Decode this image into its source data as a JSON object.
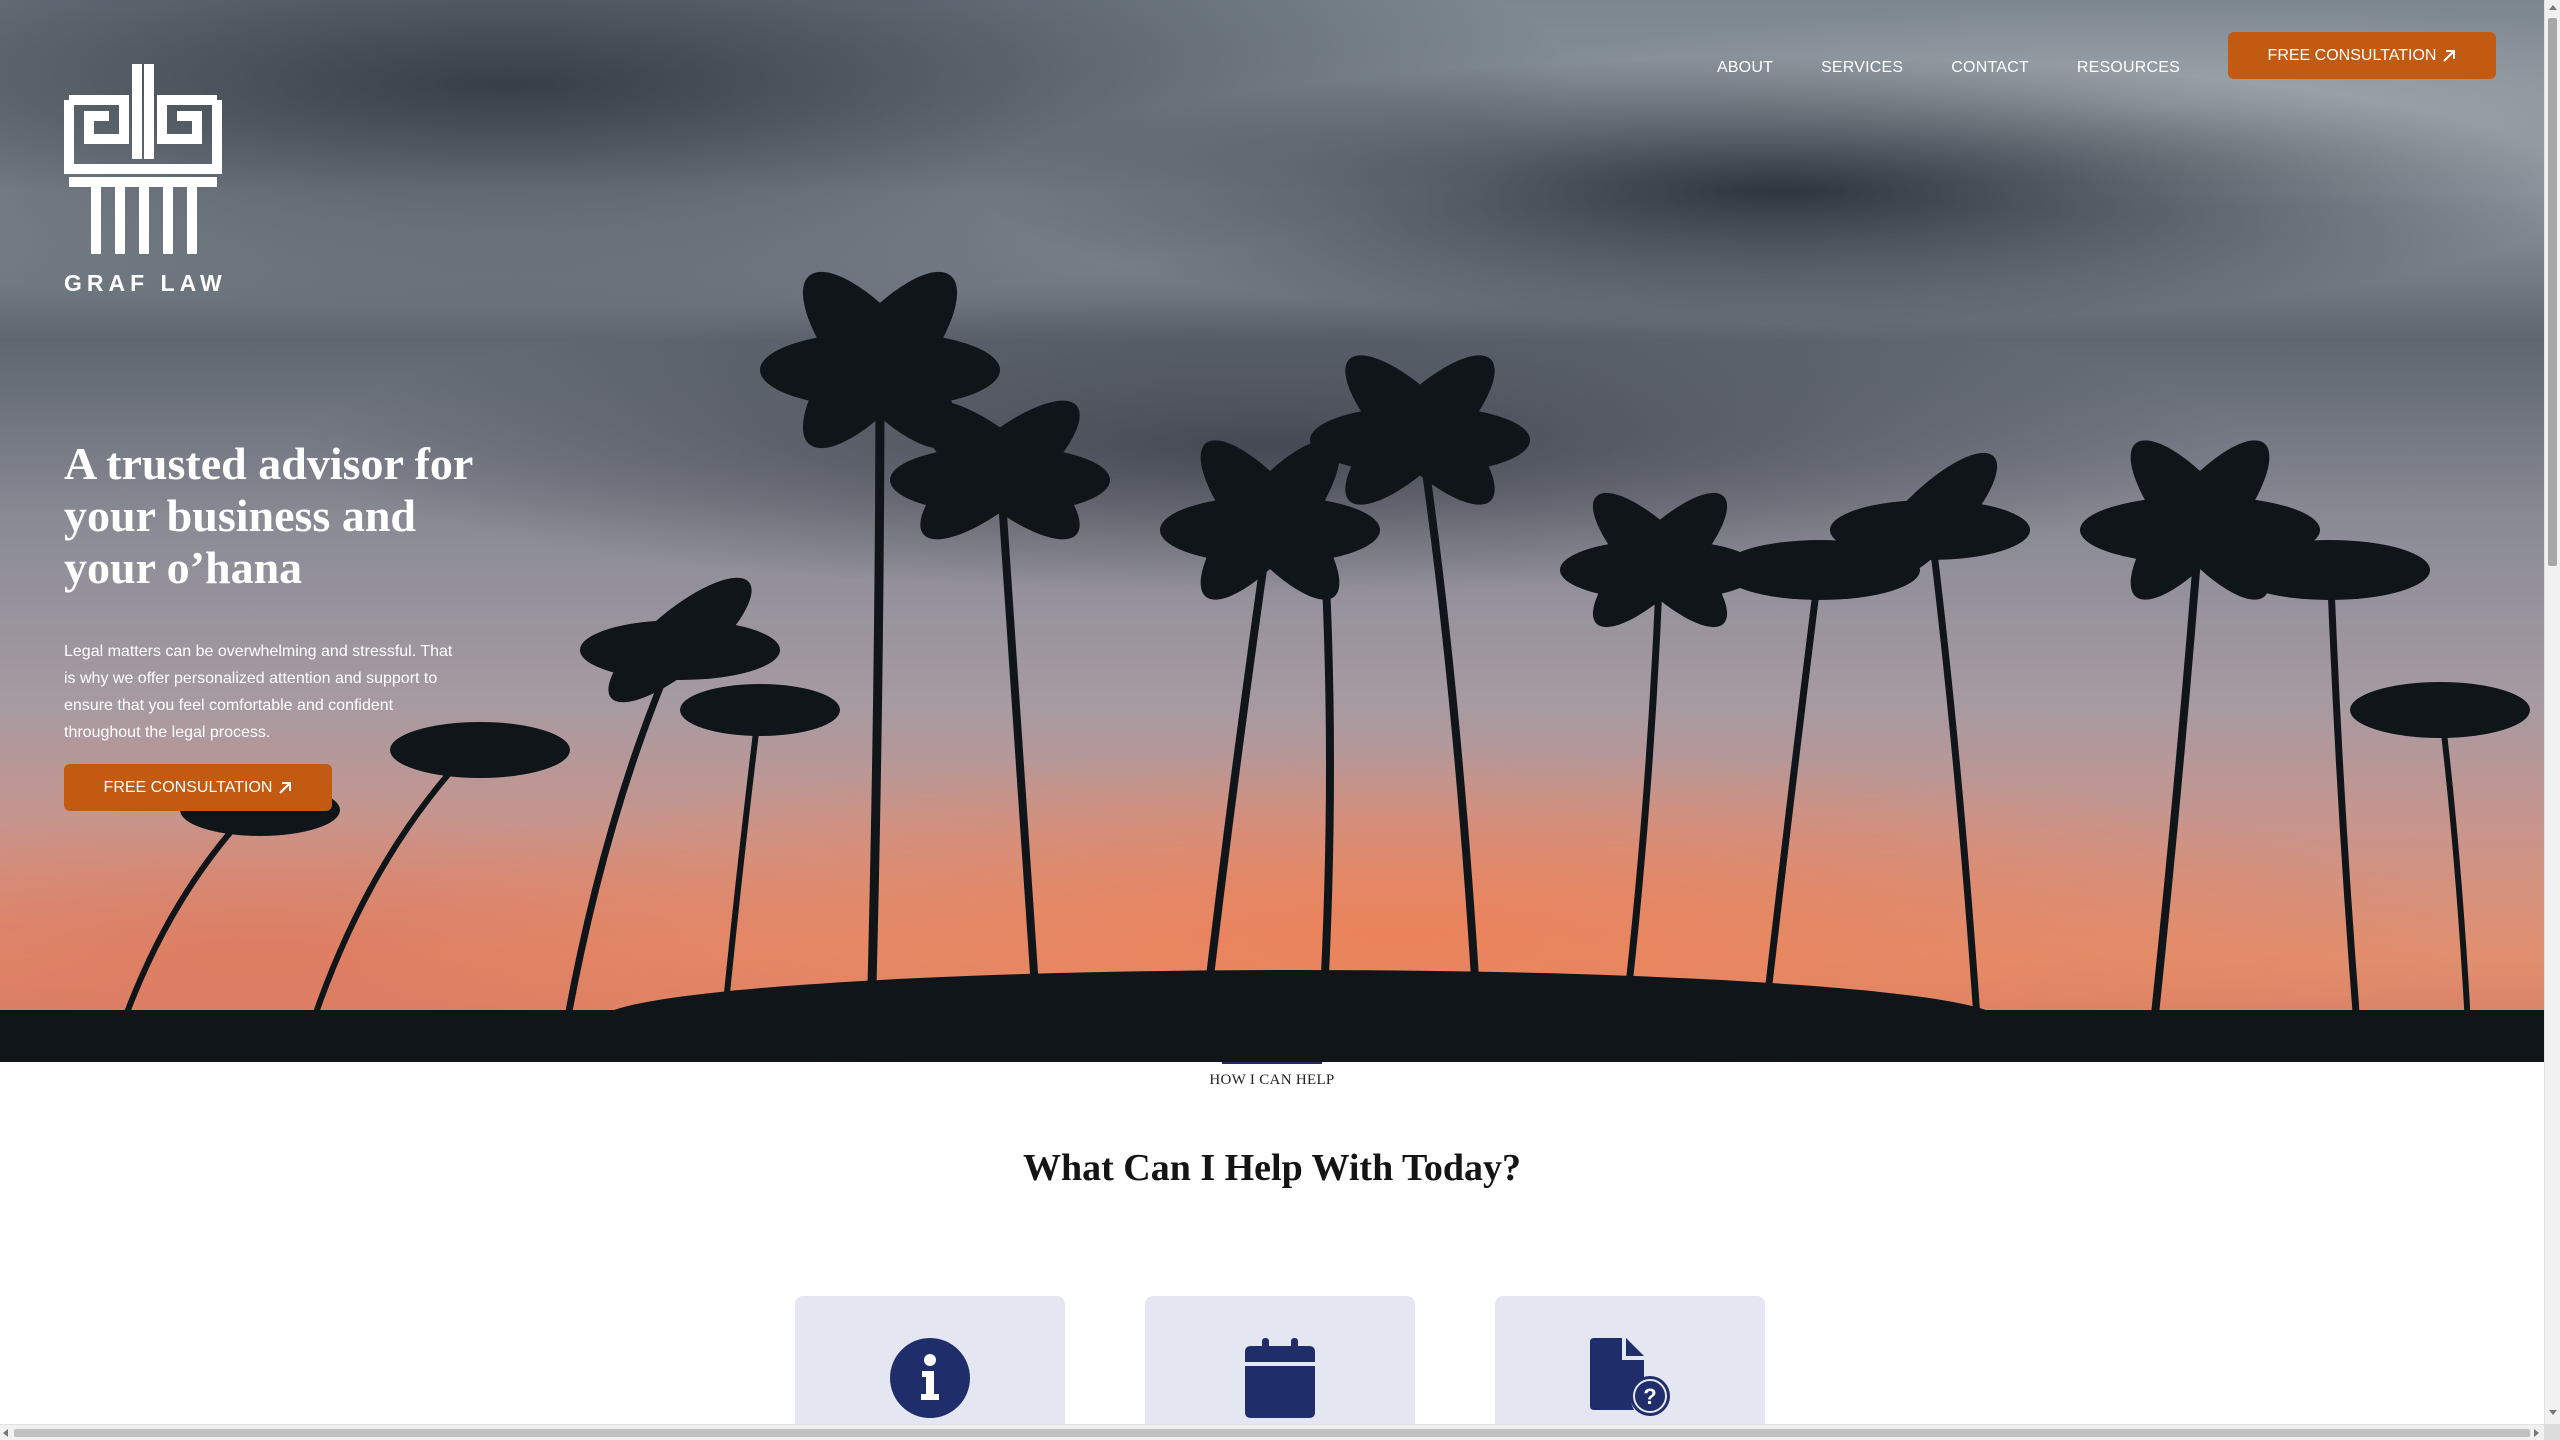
{
  "brand": {
    "name": "GRAF LAW"
  },
  "nav": {
    "items": [
      {
        "label": "ABOUT"
      },
      {
        "label": "SERVICES"
      },
      {
        "label": "CONTACT"
      },
      {
        "label": "RESOURCES"
      }
    ],
    "cta_label": "FREE CONSULTATION"
  },
  "hero": {
    "title": "A trusted advisor for your business and your o’hana",
    "body": "Legal matters can be overwhelming and stressful. That is why we offer personalized attention and support to ensure that you feel comfortable and confident throughout the legal process.",
    "cta_label": "FREE CONSULTATION"
  },
  "section": {
    "eyebrow": "HOW I CAN HELP",
    "title": "What Can I Help With Today?"
  },
  "cards": [
    {
      "icon": "info-icon"
    },
    {
      "icon": "calendar-icon"
    },
    {
      "icon": "document-question-icon"
    }
  ],
  "colors": {
    "accent": "#c25a12",
    "navy": "#1f2d6b",
    "card_bg": "#e4e7f1"
  }
}
